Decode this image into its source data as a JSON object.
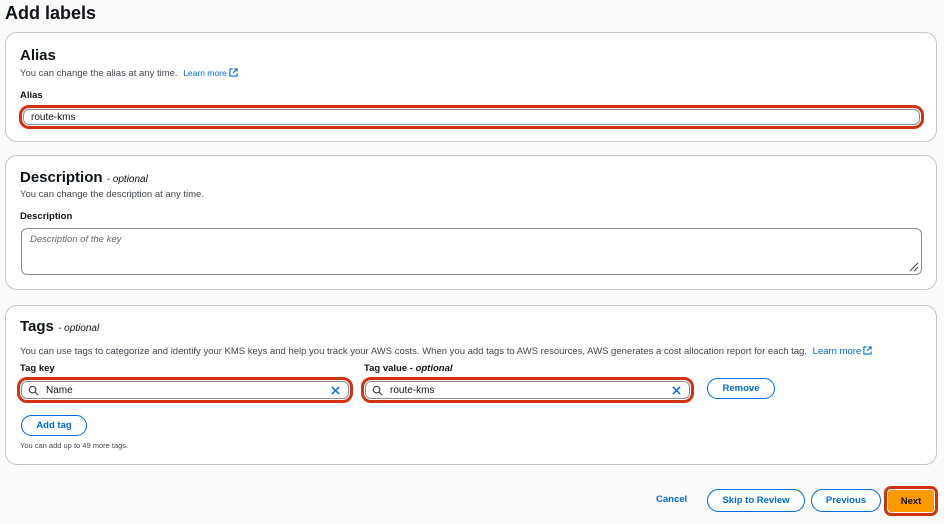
{
  "page": {
    "title": "Add labels"
  },
  "alias_panel": {
    "heading": "Alias",
    "description": "You can change the alias at any time.",
    "learn_more": "Learn more",
    "field_label": "Alias",
    "field_value": "route-kms"
  },
  "description_panel": {
    "heading": "Description",
    "heading_optional": "- optional",
    "description": "You can change the description at any time.",
    "field_label": "Description",
    "field_placeholder": "Description of the key"
  },
  "tags_panel": {
    "heading": "Tags",
    "heading_optional": "- optional",
    "description": "You can use tags to categorize and identify your KMS keys and help you track your AWS costs. When you add tags to AWS resources, AWS generates a cost allocation report for each tag.",
    "learn_more": "Learn more",
    "key_label": "Tag key",
    "value_label": "Tag value",
    "value_label_optional": "- optional",
    "key_value": "Name",
    "value_value": "route-kms",
    "remove_label": "Remove",
    "add_tag_label": "Add tag",
    "limit_note": "You can add up to 49 more tags."
  },
  "footer": {
    "cancel_label": "Cancel",
    "skip_label": "Skip to Review",
    "previous_label": "Previous",
    "next_label": "Next"
  },
  "colors": {
    "accent": "#006ce0",
    "primary_button": "#ff9900",
    "highlight": "#d13212"
  }
}
